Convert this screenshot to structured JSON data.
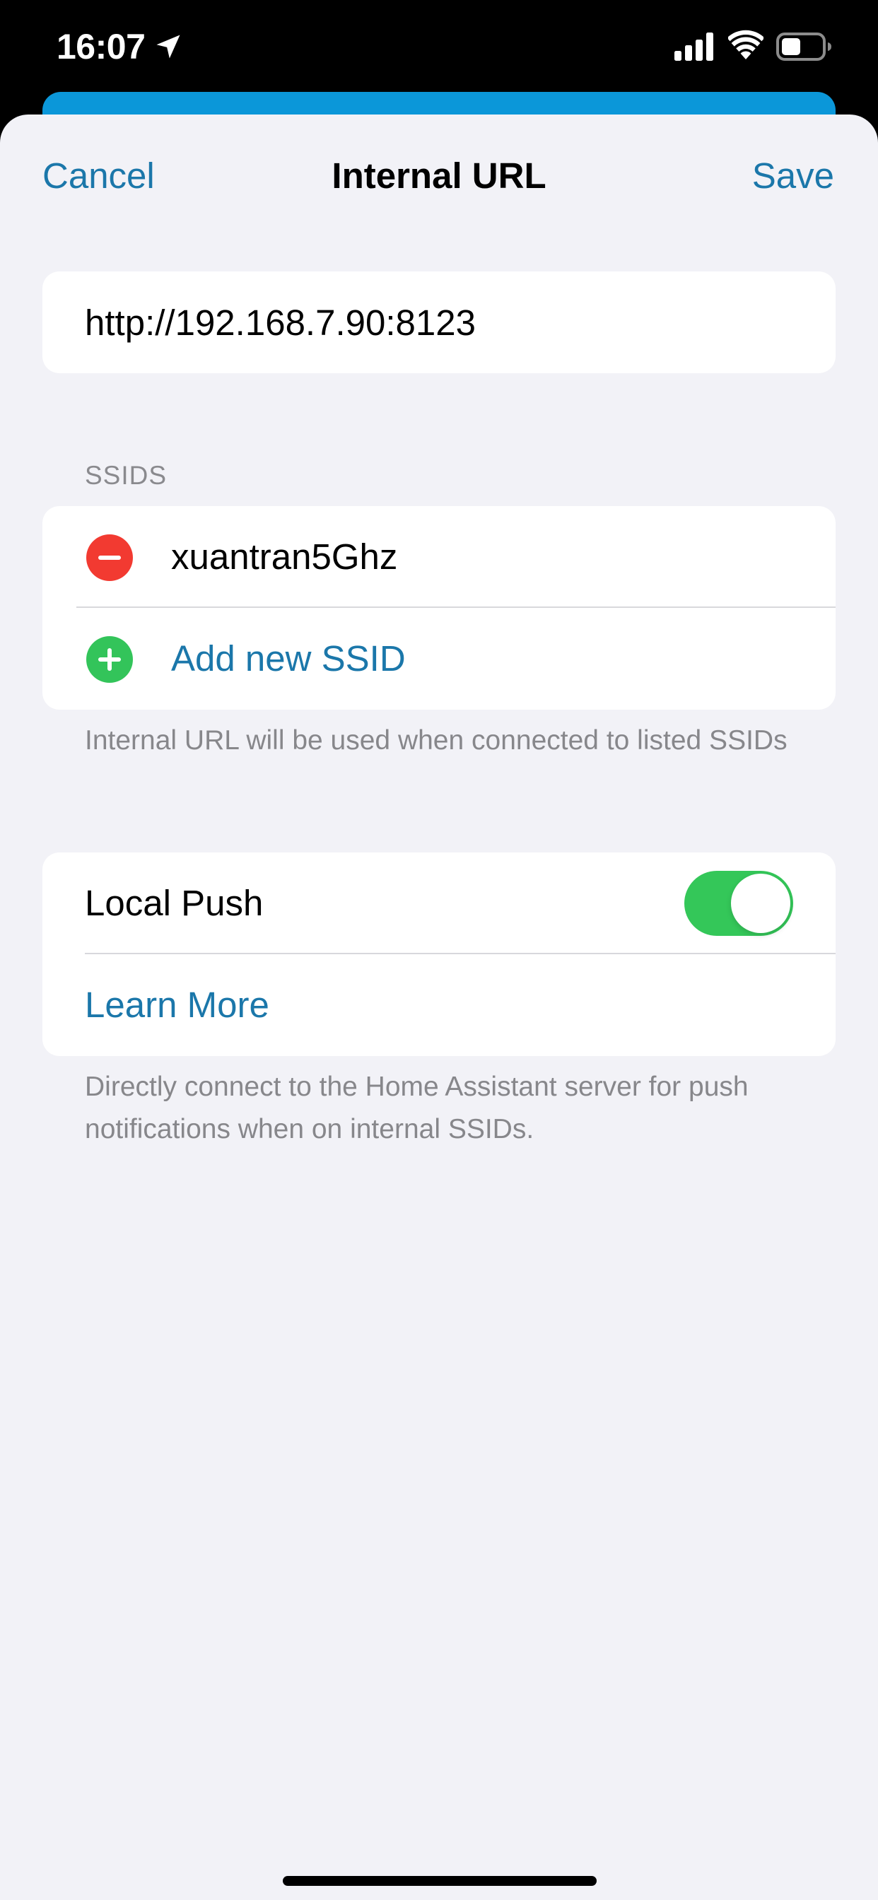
{
  "status_bar": {
    "time": "16:07",
    "icons": [
      "location-arrow-icon",
      "cellular-signal-icon",
      "wifi-icon",
      "battery-icon"
    ]
  },
  "colors": {
    "accent": "#1b77aa",
    "background_card": "#0b97d9",
    "remove": "#f23a31",
    "add": "#33c45a",
    "toggle_on": "#34c759",
    "sheet_background": "#f2f2f7"
  },
  "nav": {
    "cancel_label": "Cancel",
    "title": "Internal URL",
    "save_label": "Save"
  },
  "url_field": {
    "value": "http://192.168.7.90:8123"
  },
  "ssids": {
    "header": "SSIDS",
    "items": [
      {
        "label": "xuantran5Ghz",
        "icon": "remove-circle-icon"
      }
    ],
    "add_label": "Add new SSID",
    "add_icon": "add-circle-icon",
    "footer": "Internal URL will be used when connected to listed SSIDs"
  },
  "local_push": {
    "label": "Local Push",
    "enabled": true,
    "learn_more_label": "Learn More",
    "footer": "Directly connect to the Home Assistant server for push notifications when on internal SSIDs."
  }
}
